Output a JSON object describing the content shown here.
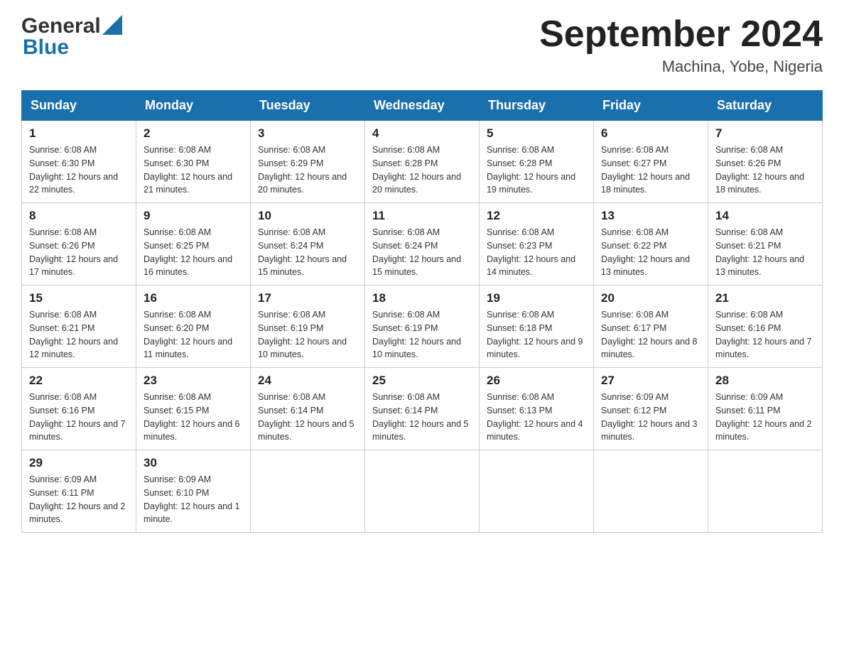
{
  "header": {
    "logo_general": "General",
    "logo_blue": "Blue",
    "month_title": "September 2024",
    "location": "Machina, Yobe, Nigeria"
  },
  "weekdays": [
    "Sunday",
    "Monday",
    "Tuesday",
    "Wednesday",
    "Thursday",
    "Friday",
    "Saturday"
  ],
  "weeks": [
    [
      {
        "day": "1",
        "sunrise": "6:08 AM",
        "sunset": "6:30 PM",
        "daylight": "12 hours and 22 minutes."
      },
      {
        "day": "2",
        "sunrise": "6:08 AM",
        "sunset": "6:30 PM",
        "daylight": "12 hours and 21 minutes."
      },
      {
        "day": "3",
        "sunrise": "6:08 AM",
        "sunset": "6:29 PM",
        "daylight": "12 hours and 20 minutes."
      },
      {
        "day": "4",
        "sunrise": "6:08 AM",
        "sunset": "6:28 PM",
        "daylight": "12 hours and 20 minutes."
      },
      {
        "day": "5",
        "sunrise": "6:08 AM",
        "sunset": "6:28 PM",
        "daylight": "12 hours and 19 minutes."
      },
      {
        "day": "6",
        "sunrise": "6:08 AM",
        "sunset": "6:27 PM",
        "daylight": "12 hours and 18 minutes."
      },
      {
        "day": "7",
        "sunrise": "6:08 AM",
        "sunset": "6:26 PM",
        "daylight": "12 hours and 18 minutes."
      }
    ],
    [
      {
        "day": "8",
        "sunrise": "6:08 AM",
        "sunset": "6:26 PM",
        "daylight": "12 hours and 17 minutes."
      },
      {
        "day": "9",
        "sunrise": "6:08 AM",
        "sunset": "6:25 PM",
        "daylight": "12 hours and 16 minutes."
      },
      {
        "day": "10",
        "sunrise": "6:08 AM",
        "sunset": "6:24 PM",
        "daylight": "12 hours and 15 minutes."
      },
      {
        "day": "11",
        "sunrise": "6:08 AM",
        "sunset": "6:24 PM",
        "daylight": "12 hours and 15 minutes."
      },
      {
        "day": "12",
        "sunrise": "6:08 AM",
        "sunset": "6:23 PM",
        "daylight": "12 hours and 14 minutes."
      },
      {
        "day": "13",
        "sunrise": "6:08 AM",
        "sunset": "6:22 PM",
        "daylight": "12 hours and 13 minutes."
      },
      {
        "day": "14",
        "sunrise": "6:08 AM",
        "sunset": "6:21 PM",
        "daylight": "12 hours and 13 minutes."
      }
    ],
    [
      {
        "day": "15",
        "sunrise": "6:08 AM",
        "sunset": "6:21 PM",
        "daylight": "12 hours and 12 minutes."
      },
      {
        "day": "16",
        "sunrise": "6:08 AM",
        "sunset": "6:20 PM",
        "daylight": "12 hours and 11 minutes."
      },
      {
        "day": "17",
        "sunrise": "6:08 AM",
        "sunset": "6:19 PM",
        "daylight": "12 hours and 10 minutes."
      },
      {
        "day": "18",
        "sunrise": "6:08 AM",
        "sunset": "6:19 PM",
        "daylight": "12 hours and 10 minutes."
      },
      {
        "day": "19",
        "sunrise": "6:08 AM",
        "sunset": "6:18 PM",
        "daylight": "12 hours and 9 minutes."
      },
      {
        "day": "20",
        "sunrise": "6:08 AM",
        "sunset": "6:17 PM",
        "daylight": "12 hours and 8 minutes."
      },
      {
        "day": "21",
        "sunrise": "6:08 AM",
        "sunset": "6:16 PM",
        "daylight": "12 hours and 7 minutes."
      }
    ],
    [
      {
        "day": "22",
        "sunrise": "6:08 AM",
        "sunset": "6:16 PM",
        "daylight": "12 hours and 7 minutes."
      },
      {
        "day": "23",
        "sunrise": "6:08 AM",
        "sunset": "6:15 PM",
        "daylight": "12 hours and 6 minutes."
      },
      {
        "day": "24",
        "sunrise": "6:08 AM",
        "sunset": "6:14 PM",
        "daylight": "12 hours and 5 minutes."
      },
      {
        "day": "25",
        "sunrise": "6:08 AM",
        "sunset": "6:14 PM",
        "daylight": "12 hours and 5 minutes."
      },
      {
        "day": "26",
        "sunrise": "6:08 AM",
        "sunset": "6:13 PM",
        "daylight": "12 hours and 4 minutes."
      },
      {
        "day": "27",
        "sunrise": "6:09 AM",
        "sunset": "6:12 PM",
        "daylight": "12 hours and 3 minutes."
      },
      {
        "day": "28",
        "sunrise": "6:09 AM",
        "sunset": "6:11 PM",
        "daylight": "12 hours and 2 minutes."
      }
    ],
    [
      {
        "day": "29",
        "sunrise": "6:09 AM",
        "sunset": "6:11 PM",
        "daylight": "12 hours and 2 minutes."
      },
      {
        "day": "30",
        "sunrise": "6:09 AM",
        "sunset": "6:10 PM",
        "daylight": "12 hours and 1 minute."
      },
      null,
      null,
      null,
      null,
      null
    ]
  ]
}
